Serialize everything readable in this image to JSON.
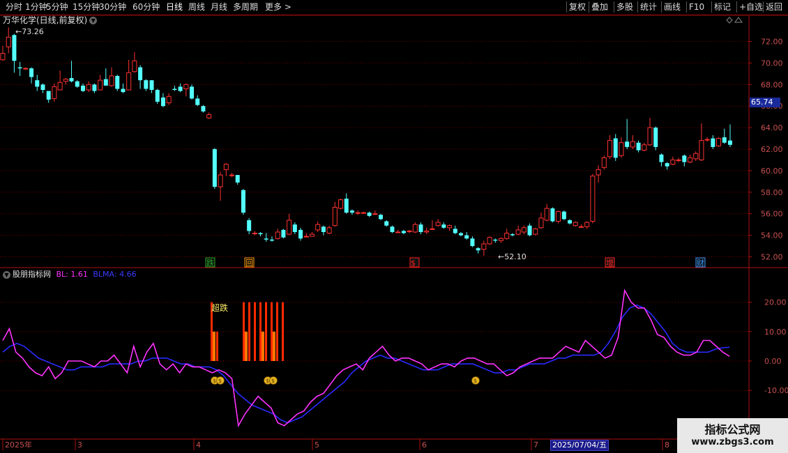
{
  "toolbar": {
    "left": [
      "分时",
      "1分钟",
      "5分钟",
      "15分钟",
      "30分钟",
      "60分钟",
      "日线",
      "周线",
      "月线",
      "多周期",
      "更多 >"
    ],
    "right": [
      "复权",
      "叠加",
      "多股",
      "统计",
      "画线",
      "F10",
      "标记",
      "+自选",
      "返回"
    ],
    "active_index": 6
  },
  "main": {
    "title": "万华化学(日线,前复权)",
    "high_label": "73.26",
    "low_label": "52.10",
    "current_price": "65.74",
    "y_ticks": [
      "72.00",
      "70.00",
      "68.00",
      "66.00",
      "64.00",
      "62.00",
      "60.00",
      "58.00",
      "56.00",
      "54.00",
      "52.00"
    ],
    "markers": [
      "跌",
      "回",
      "$",
      "增",
      "财"
    ]
  },
  "indicator": {
    "name": "股朋指标网",
    "bl_label": "BL: 1.61",
    "blma_label": "BLMA: 4.66",
    "text_label": "超跌",
    "y_ticks": [
      "20.00",
      "10.00",
      "0.00",
      "-10.00"
    ],
    "colors": {
      "bl": "#ff33ff",
      "blma": "#2a2aff",
      "bar": "#ff2a00",
      "bar2": "#ff7700"
    }
  },
  "date_axis": {
    "labels": [
      "2025年",
      "3",
      "4",
      "5",
      "6",
      "7",
      "8"
    ],
    "cursor_date": "2025/07/04/五"
  },
  "watermark": {
    "line1": "指标公式网",
    "line2": "www.zbgs3.com"
  },
  "colors": {
    "up": "#ff3232",
    "down": "#54ffff",
    "grid": "#7a0000",
    "axis": "#b01010"
  }
}
